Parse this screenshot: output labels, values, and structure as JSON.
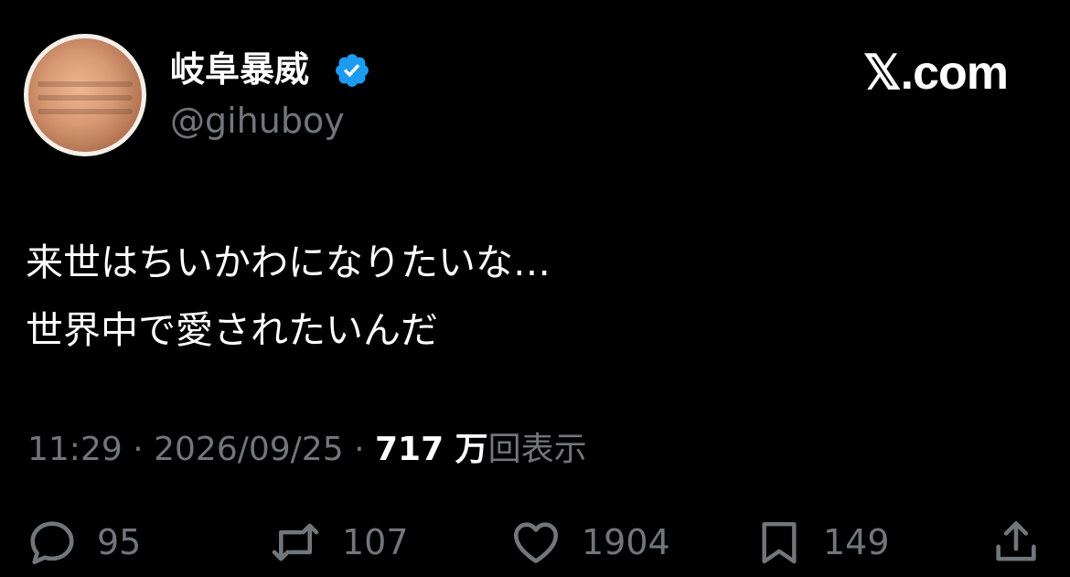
{
  "user": {
    "display_name": "岐阜暴威",
    "handle": "@gihuboy",
    "verified": true
  },
  "brand": {
    "label": "𝕏.com"
  },
  "tweet": {
    "lines": [
      "来世はちいかわになりたいな…",
      "世界中で愛されたいんだ"
    ]
  },
  "meta": {
    "time": "11:29",
    "separator": "·",
    "date": "2026/09/25",
    "views_count": "717 万",
    "views_label": "回表示"
  },
  "actions": {
    "replies": "95",
    "retweets": "107",
    "likes": "1904",
    "bookmarks": "149"
  },
  "colors": {
    "background": "#000000",
    "text": "#ffffff",
    "secondary": "#71767b",
    "verified": "#1d9bf0"
  }
}
